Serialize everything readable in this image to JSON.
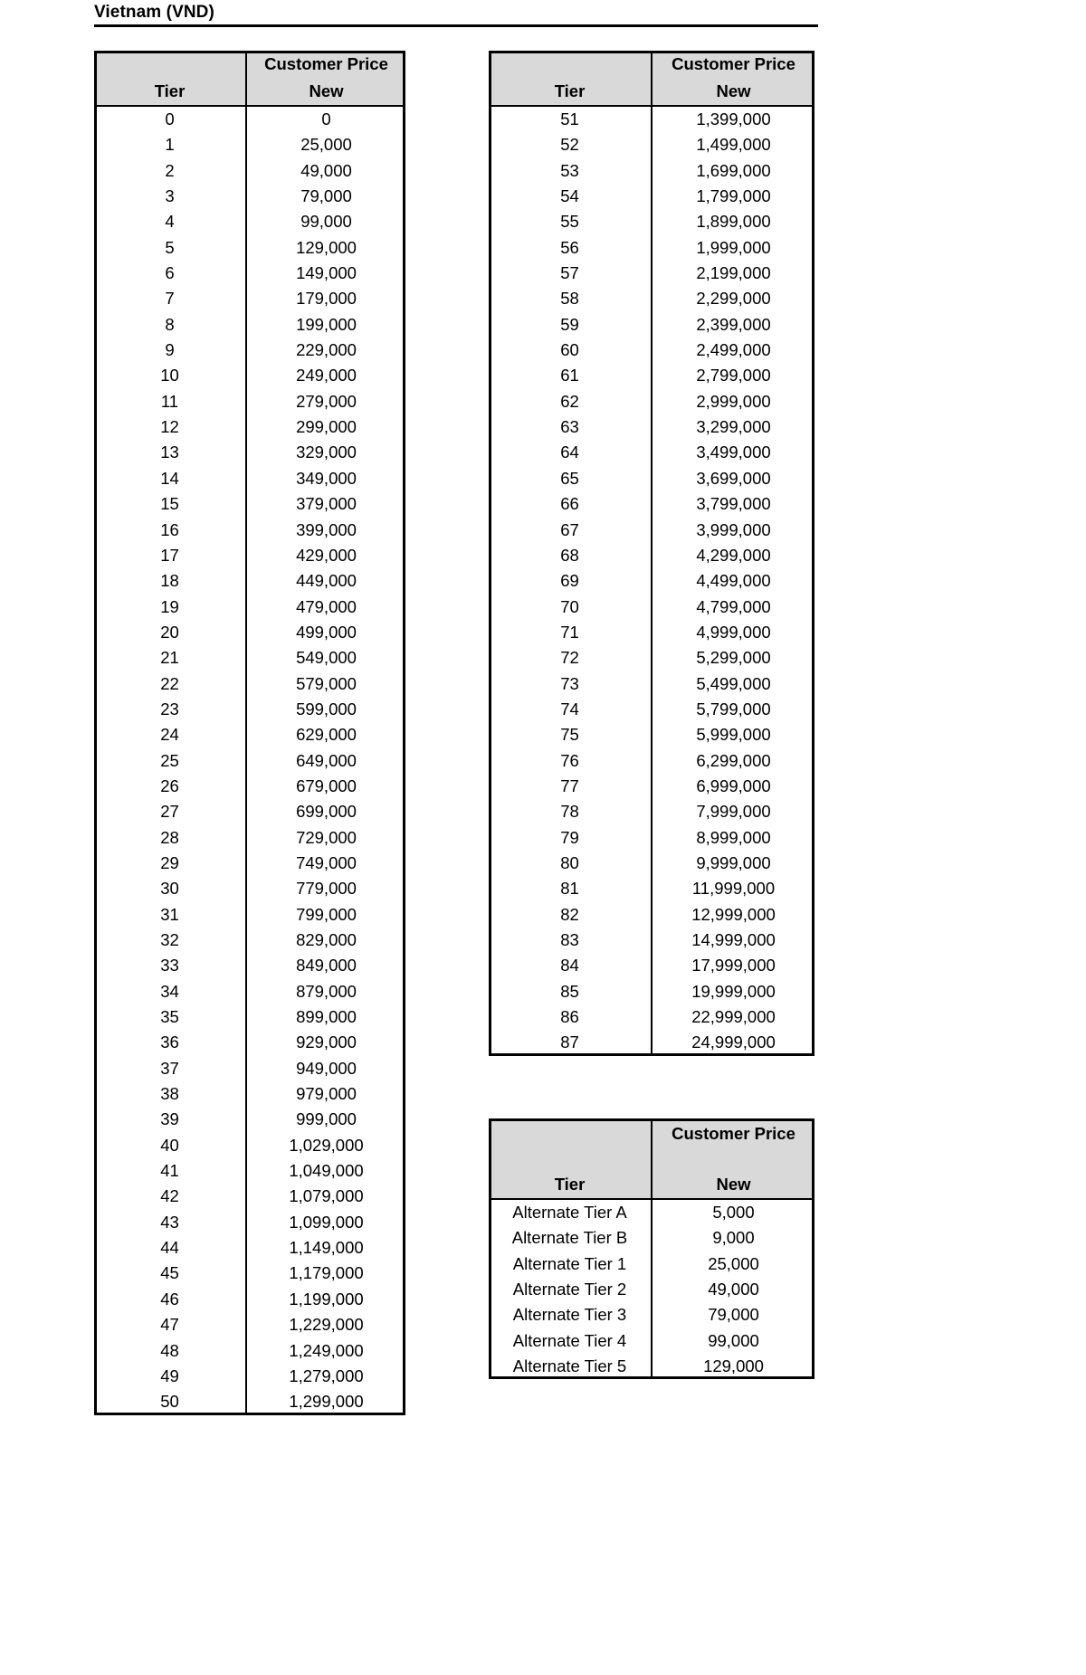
{
  "document": {
    "title": "Vietnam (VND)"
  },
  "tables": {
    "left": {
      "name": "tier-price-table-left",
      "headers": {
        "group": "Customer Price",
        "tier": "Tier",
        "price": "New"
      },
      "rows": [
        {
          "tier": "0",
          "price": "0"
        },
        {
          "tier": "1",
          "price": "25,000"
        },
        {
          "tier": "2",
          "price": "49,000"
        },
        {
          "tier": "3",
          "price": "79,000"
        },
        {
          "tier": "4",
          "price": "99,000"
        },
        {
          "tier": "5",
          "price": "129,000"
        },
        {
          "tier": "6",
          "price": "149,000"
        },
        {
          "tier": "7",
          "price": "179,000"
        },
        {
          "tier": "8",
          "price": "199,000"
        },
        {
          "tier": "9",
          "price": "229,000"
        },
        {
          "tier": "10",
          "price": "249,000"
        },
        {
          "tier": "11",
          "price": "279,000"
        },
        {
          "tier": "12",
          "price": "299,000"
        },
        {
          "tier": "13",
          "price": "329,000"
        },
        {
          "tier": "14",
          "price": "349,000"
        },
        {
          "tier": "15",
          "price": "379,000"
        },
        {
          "tier": "16",
          "price": "399,000"
        },
        {
          "tier": "17",
          "price": "429,000"
        },
        {
          "tier": "18",
          "price": "449,000"
        },
        {
          "tier": "19",
          "price": "479,000"
        },
        {
          "tier": "20",
          "price": "499,000"
        },
        {
          "tier": "21",
          "price": "549,000"
        },
        {
          "tier": "22",
          "price": "579,000"
        },
        {
          "tier": "23",
          "price": "599,000"
        },
        {
          "tier": "24",
          "price": "629,000"
        },
        {
          "tier": "25",
          "price": "649,000"
        },
        {
          "tier": "26",
          "price": "679,000"
        },
        {
          "tier": "27",
          "price": "699,000"
        },
        {
          "tier": "28",
          "price": "729,000"
        },
        {
          "tier": "29",
          "price": "749,000"
        },
        {
          "tier": "30",
          "price": "779,000"
        },
        {
          "tier": "31",
          "price": "799,000"
        },
        {
          "tier": "32",
          "price": "829,000"
        },
        {
          "tier": "33",
          "price": "849,000"
        },
        {
          "tier": "34",
          "price": "879,000"
        },
        {
          "tier": "35",
          "price": "899,000"
        },
        {
          "tier": "36",
          "price": "929,000"
        },
        {
          "tier": "37",
          "price": "949,000"
        },
        {
          "tier": "38",
          "price": "979,000"
        },
        {
          "tier": "39",
          "price": "999,000"
        },
        {
          "tier": "40",
          "price": "1,029,000"
        },
        {
          "tier": "41",
          "price": "1,049,000"
        },
        {
          "tier": "42",
          "price": "1,079,000"
        },
        {
          "tier": "43",
          "price": "1,099,000"
        },
        {
          "tier": "44",
          "price": "1,149,000"
        },
        {
          "tier": "45",
          "price": "1,179,000"
        },
        {
          "tier": "46",
          "price": "1,199,000"
        },
        {
          "tier": "47",
          "price": "1,229,000"
        },
        {
          "tier": "48",
          "price": "1,249,000"
        },
        {
          "tier": "49",
          "price": "1,279,000"
        },
        {
          "tier": "50",
          "price": "1,299,000"
        }
      ]
    },
    "right": {
      "name": "tier-price-table-right",
      "headers": {
        "group": "Customer Price",
        "tier": "Tier",
        "price": "New"
      },
      "rows": [
        {
          "tier": "51",
          "price": "1,399,000"
        },
        {
          "tier": "52",
          "price": "1,499,000"
        },
        {
          "tier": "53",
          "price": "1,699,000"
        },
        {
          "tier": "54",
          "price": "1,799,000"
        },
        {
          "tier": "55",
          "price": "1,899,000"
        },
        {
          "tier": "56",
          "price": "1,999,000"
        },
        {
          "tier": "57",
          "price": "2,199,000"
        },
        {
          "tier": "58",
          "price": "2,299,000"
        },
        {
          "tier": "59",
          "price": "2,399,000"
        },
        {
          "tier": "60",
          "price": "2,499,000"
        },
        {
          "tier": "61",
          "price": "2,799,000"
        },
        {
          "tier": "62",
          "price": "2,999,000"
        },
        {
          "tier": "63",
          "price": "3,299,000"
        },
        {
          "tier": "64",
          "price": "3,499,000"
        },
        {
          "tier": "65",
          "price": "3,699,000"
        },
        {
          "tier": "66",
          "price": "3,799,000"
        },
        {
          "tier": "67",
          "price": "3,999,000"
        },
        {
          "tier": "68",
          "price": "4,299,000"
        },
        {
          "tier": "69",
          "price": "4,499,000"
        },
        {
          "tier": "70",
          "price": "4,799,000"
        },
        {
          "tier": "71",
          "price": "4,999,000"
        },
        {
          "tier": "72",
          "price": "5,299,000"
        },
        {
          "tier": "73",
          "price": "5,499,000"
        },
        {
          "tier": "74",
          "price": "5,799,000"
        },
        {
          "tier": "75",
          "price": "5,999,000"
        },
        {
          "tier": "76",
          "price": "6,299,000"
        },
        {
          "tier": "77",
          "price": "6,999,000"
        },
        {
          "tier": "78",
          "price": "7,999,000"
        },
        {
          "tier": "79",
          "price": "8,999,000"
        },
        {
          "tier": "80",
          "price": "9,999,000"
        },
        {
          "tier": "81",
          "price": "11,999,000"
        },
        {
          "tier": "82",
          "price": "12,999,000"
        },
        {
          "tier": "83",
          "price": "14,999,000"
        },
        {
          "tier": "84",
          "price": "17,999,000"
        },
        {
          "tier": "85",
          "price": "19,999,000"
        },
        {
          "tier": "86",
          "price": "22,999,000"
        },
        {
          "tier": "87",
          "price": "24,999,000"
        }
      ]
    },
    "alternate": {
      "name": "alternate-tier-price-table",
      "headers": {
        "group": "Customer Price",
        "tier": "Tier",
        "price": "New"
      },
      "rows": [
        {
          "tier": "Alternate Tier A",
          "price": "5,000"
        },
        {
          "tier": "Alternate Tier B",
          "price": "9,000"
        },
        {
          "tier": "Alternate Tier 1",
          "price": "25,000"
        },
        {
          "tier": "Alternate Tier 2",
          "price": "49,000"
        },
        {
          "tier": "Alternate Tier 3",
          "price": "79,000"
        },
        {
          "tier": "Alternate Tier 4",
          "price": "99,000"
        },
        {
          "tier": "Alternate Tier 5",
          "price": "129,000"
        }
      ]
    }
  },
  "colors": {
    "header_fill": "#d9d9d9",
    "border": "#000000",
    "text": "#000000",
    "background": "#ffffff"
  }
}
